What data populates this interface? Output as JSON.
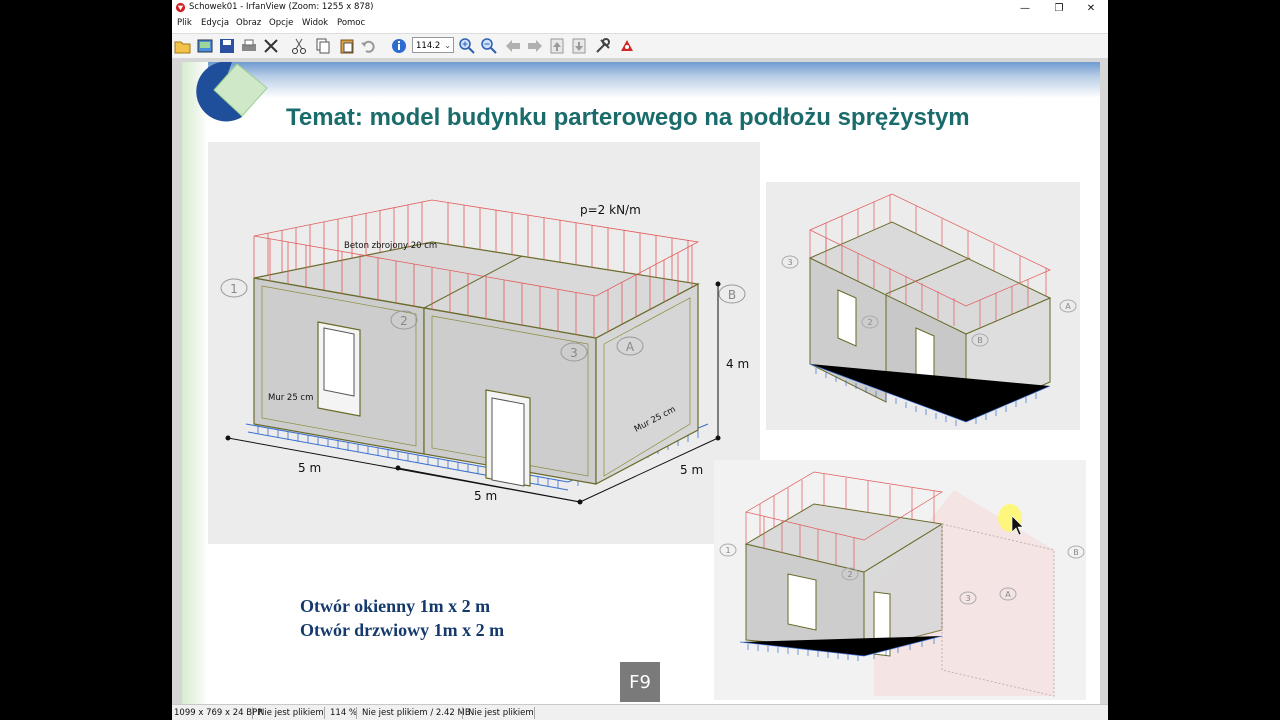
{
  "window": {
    "title": "Schowek01 - IrfanView (Zoom: 1255 x 878)",
    "controls": {
      "minimize": "—",
      "maximize": "❐",
      "close": "✕"
    }
  },
  "menu": [
    "Plik",
    "Edycja",
    "Obraz",
    "Opcje",
    "Widok",
    "Pomoc"
  ],
  "toolbar": {
    "zoom_value": "114.2",
    "icons": [
      "open-icon",
      "thumbnails-icon",
      "save-icon",
      "print-icon",
      "delete-icon",
      "cut-icon",
      "copy-icon",
      "paste-icon",
      "undo-icon",
      "info-icon",
      "zoom-in-icon",
      "zoom-out-icon",
      "previous-icon",
      "next-icon",
      "first-page-icon",
      "last-page-icon",
      "settings-icon",
      "exit-icon"
    ]
  },
  "slide": {
    "title": "Temat: model budynku parterowego na podłożu sprężystym",
    "diagram_main": {
      "load_label": "p=2 kN/m",
      "slab_label": "Beton zbrojony 20 cm",
      "wall_label_left": "Mur 25 cm",
      "wall_label_right": "Mur 25 cm",
      "height_label": "4 m",
      "dim_front_left": "5 m",
      "dim_front_right": "5 m",
      "dim_side": "5 m",
      "axis_labels": [
        "1",
        "2",
        "3",
        "A",
        "B"
      ]
    },
    "diagram_top_right": {
      "axis_labels": [
        "3",
        "2",
        "B",
        "A"
      ]
    },
    "diagram_bottom_right": {
      "axis_labels": [
        "1",
        "2",
        "3",
        "A",
        "B"
      ]
    },
    "caption_line1": "Otwór okienny 1m x 2 m",
    "caption_line2": "Otwór drzwiowy 1m x 2 m"
  },
  "overlay_key": "F9",
  "status": {
    "image_info": "1099 x 769 x 24 BPP",
    "file_state": "Nie jest plikiem",
    "zoom": "114 %",
    "size_info": "Nie jest plikiem / 2.42 MB",
    "extra": "Nie jest plikiem"
  },
  "colors": {
    "title_teal": "#1a6b6b",
    "caption_navy": "#143a6b",
    "load_red": "#e25a5a",
    "support_blue": "#3a6fd0"
  }
}
